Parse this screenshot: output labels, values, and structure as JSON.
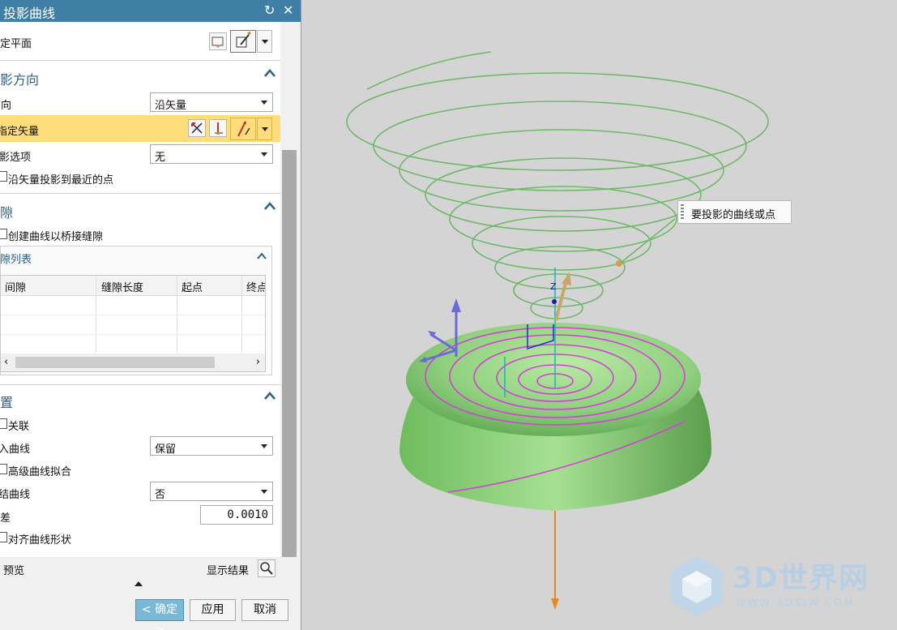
{
  "dialog": {
    "title": "投影曲线",
    "specify_plane_label": "指定平面",
    "direction_section": {
      "title": "投影方向",
      "direction_label": "方向",
      "direction_value": "沿矢量",
      "specify_vector_label": "指定矢量",
      "projection_option_label": "投影选项",
      "projection_option_value": "无",
      "nearest_point_label": "沿矢量投影到最近的点"
    },
    "gap_section": {
      "title": "缝隙",
      "bridge_label": "创建曲线以桥接缝隙",
      "list_title": "缝隙列表",
      "columns": [
        "间隙",
        "缝隙长度",
        "起点",
        "终点"
      ]
    },
    "settings_section": {
      "title": "设置",
      "associative_label": "关联",
      "input_curves_label": "输入曲线",
      "input_curves_value": "保留",
      "advanced_fit_label": "高级曲线拟合",
      "join_curves_label": "连结曲线",
      "join_curves_value": "否",
      "tolerance_label": "公差",
      "tolerance_value": "0.0010",
      "align_shape_label": "对齐曲线形状"
    },
    "preview_label": "预览",
    "show_result_label": "显示结果",
    "ok_label": "< 确定 >",
    "apply_label": "应用",
    "cancel_label": "取消"
  },
  "viewport": {
    "tooltip": "要投影的曲线或点",
    "watermark_text": "3D世界网",
    "watermark_url": "WWW.3DSJW.COM",
    "colors": {
      "background": "#d4d4d4",
      "dome": "#8fd07e",
      "spiral": "#6fb86a",
      "projected": "#d63fd6",
      "accent": "#3f7fa6"
    }
  }
}
